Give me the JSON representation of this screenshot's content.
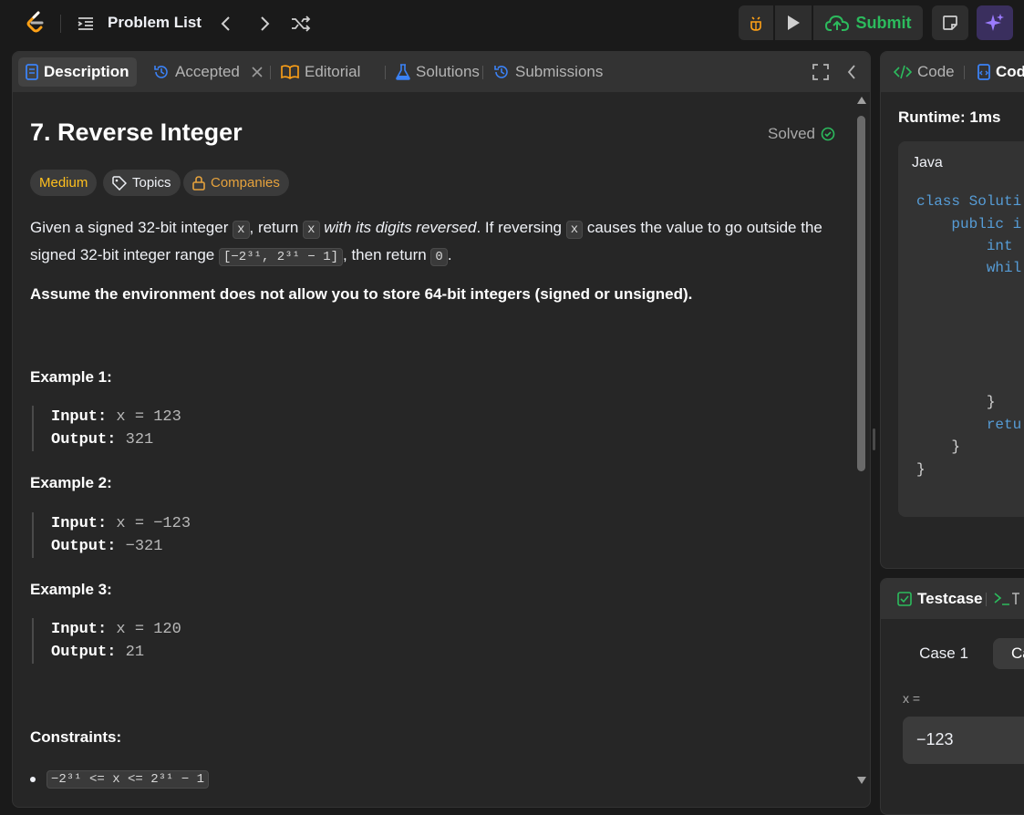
{
  "topbar": {
    "problem_list": "Problem List",
    "submit": "Submit"
  },
  "tabs": {
    "description": "Description",
    "accepted": "Accepted",
    "editorial": "Editorial",
    "solutions": "Solutions",
    "submissions": "Submissions"
  },
  "problem": {
    "title": "7. Reverse Integer",
    "status": "Solved",
    "difficulty": "Medium",
    "topics": "Topics",
    "companies": "Companies",
    "desc_1": "Given a signed 32-bit integer ",
    "code_x": "x",
    "desc_2": ", return ",
    "desc_3_italic": " with its digits reversed",
    "desc_4": ". If reversing ",
    "desc_5": " causes the value to go outside the signed 32-bit integer range ",
    "range_code": "[−2³¹, 2³¹ − 1]",
    "desc_6": ", then return ",
    "zero_code": "0",
    "desc_7": ".",
    "assumption": "Assume the environment does not allow you to store 64-bit integers (signed or unsigned).",
    "examples": [
      {
        "heading": "Example 1:",
        "input_label": "Input:",
        "input_value": " x = 123",
        "output_label": "Output:",
        "output_value": " 321"
      },
      {
        "heading": "Example 2:",
        "input_label": "Input:",
        "input_value": " x = −123",
        "output_label": "Output:",
        "output_value": " −321"
      },
      {
        "heading": "Example 3:",
        "input_label": "Input:",
        "input_value": " x = 120",
        "output_label": "Output:",
        "output_value": " 21"
      }
    ],
    "constraints_heading": "Constraints:",
    "constraint_1": "−2³¹ <= x <= 2³¹ − 1"
  },
  "code_panel": {
    "tab_code": "Code",
    "tab_code2": "Cod",
    "runtime": "Runtime: 1ms",
    "language": "Java",
    "lines": [
      "class Soluti",
      "    public i",
      "        int",
      "        whil",
      "        }",
      "        retu",
      "    }",
      "}"
    ]
  },
  "testcase": {
    "tab": "Testcase",
    "case1": "Case 1",
    "case2": "Ca",
    "var_label": "x =",
    "var_value": "−123"
  },
  "colors": {
    "accent_green": "#2cbb5d",
    "medium_yellow": "#ffc01e",
    "companies_gold": "#e6a23c",
    "tab_blue": "#3b82f6",
    "purple": "#9b7bff"
  }
}
